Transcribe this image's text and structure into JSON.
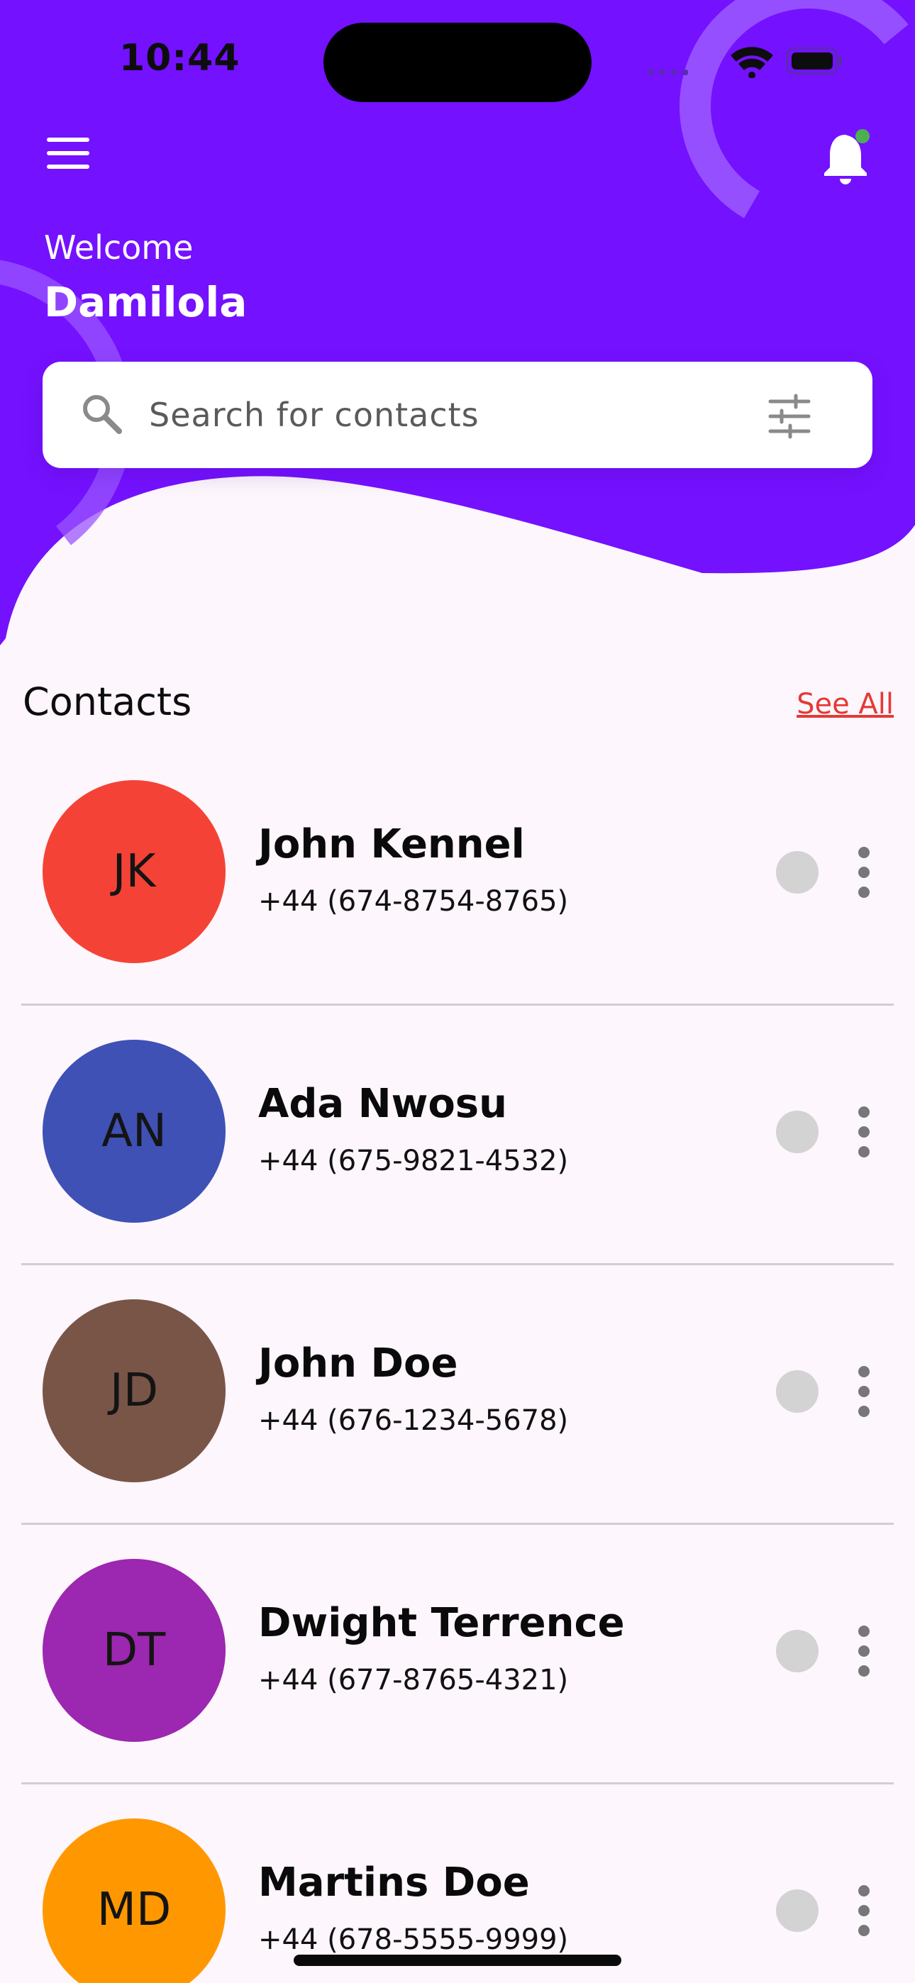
{
  "status_bar": {
    "time": "10:44"
  },
  "header": {
    "welcome_label": "Welcome",
    "username": "Damilola",
    "background_color": "#7411ff",
    "notification_badge_color": "#4caf50"
  },
  "search": {
    "placeholder": "Search for contacts"
  },
  "contacts_section": {
    "title": "Contacts",
    "see_all_label": "See All",
    "items": [
      {
        "initials": "JK",
        "name": "John Kennel",
        "phone": "+44 (674-8754-8765)",
        "color": "#f44336"
      },
      {
        "initials": "AN",
        "name": "Ada Nwosu",
        "phone": "+44 (675-9821-4532)",
        "color": "#3f51b5"
      },
      {
        "initials": "JD",
        "name": "John Doe",
        "phone": "+44 (676-1234-5678)",
        "color": "#795548"
      },
      {
        "initials": "DT",
        "name": "Dwight Terrence",
        "phone": "+44 (677-8765-4321)",
        "color": "#9c27b0"
      },
      {
        "initials": "MD",
        "name": "Martins Doe",
        "phone": "+44 (678-5555-9999)",
        "color": "#ff9800"
      }
    ]
  }
}
